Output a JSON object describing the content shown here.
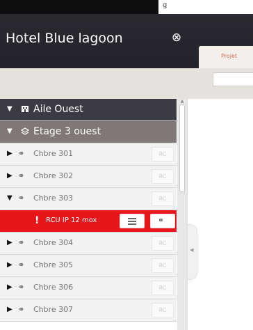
{
  "top": {
    "title_fragment": "g"
  },
  "header": {
    "title": "Hotel Blue lagoon",
    "close_symbol": "⊗",
    "tab_label": "Projet"
  },
  "tree": {
    "wing": {
      "label": "Aile Ouest",
      "arrow": "▼",
      "icon": "building-icon"
    },
    "floor": {
      "label": "Etage 3 ouest",
      "arrow": "▼",
      "icon": "floor-icon"
    },
    "rooms": [
      {
        "label": "Chbre 301",
        "arrow": "▶",
        "badge": "RC"
      },
      {
        "label": "Chbre 302",
        "arrow": "▶",
        "badge": "RC"
      },
      {
        "label": "Chbre 303",
        "arrow": "▼",
        "badge": "RC"
      }
    ],
    "alert": {
      "label": "RCU IP 12 mox",
      "symbol": "!"
    },
    "rooms_after": [
      {
        "label": "Chbre 304",
        "arrow": "▶",
        "badge": "RC"
      },
      {
        "label": "Chbre 305",
        "arrow": "▶",
        "badge": "RC"
      },
      {
        "label": "Chbre 306",
        "arrow": "▶",
        "badge": "RC"
      },
      {
        "label": "Chbre 307",
        "arrow": "▶",
        "badge": "RC"
      }
    ]
  },
  "colors": {
    "header": "#23242a",
    "alert": "#e8151a",
    "wing_row": "#3b3c43",
    "floor_row": "#7f7877"
  }
}
